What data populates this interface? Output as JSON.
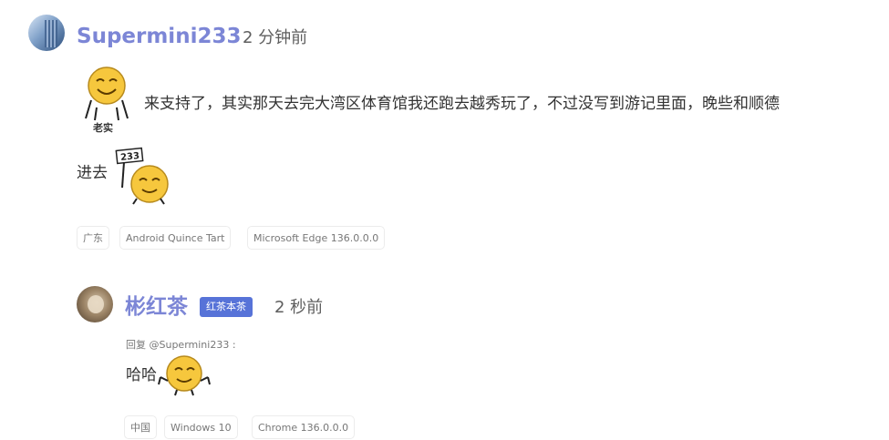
{
  "comment": {
    "username": "Supermini233",
    "time": "2 分钟前",
    "emoji_1": {
      "icon": "laugh-emoji-icon",
      "caption": "老实"
    },
    "text_line_1": "来支持了，其实那天去完大湾区体育馆我还跑去越秀玩了，不过没写到游记里面，晚些和顺德",
    "text_line_2": "进去",
    "emoji_2": {
      "icon": "sign-emoji-icon",
      "sign_text": "233"
    },
    "tags": [
      "广东",
      "Android Quince Tart",
      "Microsoft Edge 136.0.0.0"
    ]
  },
  "reply": {
    "username": "彬红茶",
    "badge": "红茶本茶",
    "time": "2 秒前",
    "reply_to": "回复 @Supermini233 :",
    "text": "哈哈",
    "emoji": {
      "icon": "shrug-emoji-icon"
    },
    "tags": [
      "中国",
      "Windows 10",
      "Chrome 136.0.0.0"
    ]
  },
  "colors": {
    "username": "#7c86d6",
    "badge": "#5773d8",
    "emoji_yellow": "#f6c73d"
  }
}
